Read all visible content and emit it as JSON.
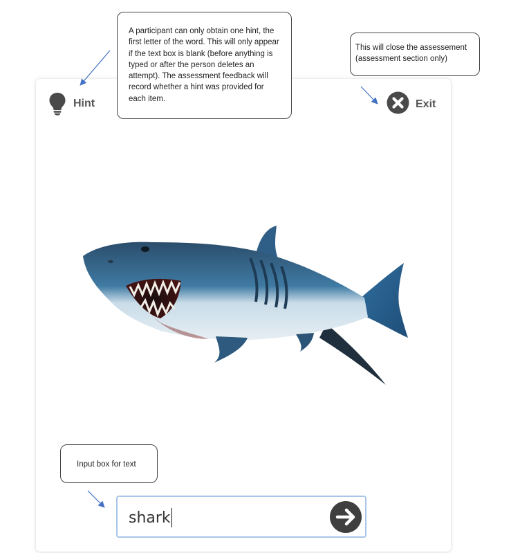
{
  "toolbar": {
    "hint_label": "Hint",
    "exit_label": "Exit"
  },
  "annotations": {
    "hint_note": "A participant can only obtain one hint, the first letter of the word. This will only appear if the text box is blank (before anything is typed or after the person deletes an attempt). The assessment feedback will record whether a hint was provided for each item.",
    "exit_note": "This will close the assessement (assessment section only)",
    "input_note": "Input box for text"
  },
  "answer": {
    "value": "shark"
  },
  "icons": {
    "hint": "lightbulb-icon",
    "exit": "close-circle-icon",
    "submit": "arrow-right-circle-icon"
  },
  "colors": {
    "icon_dark": "#4a4a4a",
    "arrow_blue": "#4472c4",
    "input_border": "#a9c6e8"
  }
}
